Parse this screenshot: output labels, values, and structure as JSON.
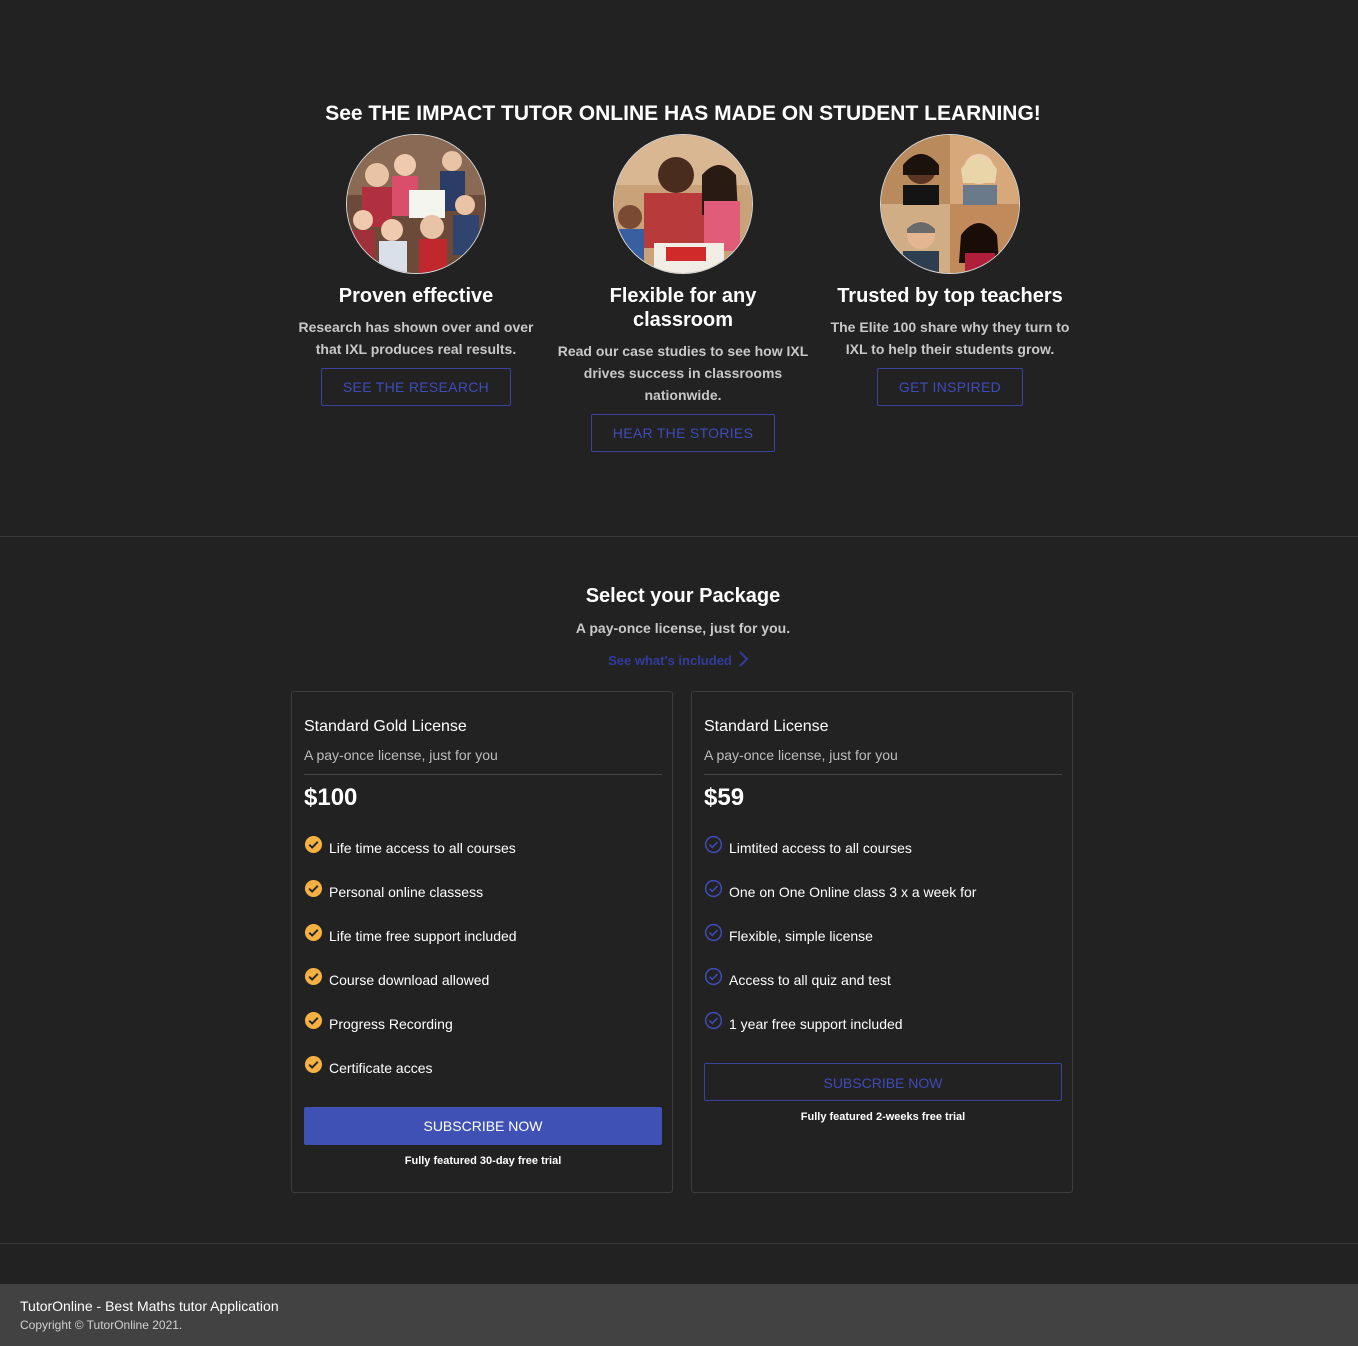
{
  "impact": {
    "title": "See THE IMPACT TUTOR ONLINE HAS MADE ON STUDENT LEARNING!",
    "features": [
      {
        "photo": "students-group-photo",
        "heading": "Proven effective",
        "text": "Research has shown over and over that IXL produces real results.",
        "button": "SEE THE RESEARCH"
      },
      {
        "photo": "teacher-with-students-photo",
        "heading": "Flexible for any classroom",
        "text": "Read our case studies to see how IXL drives success in classrooms nationwide.",
        "button": "HEAR THE STORIES"
      },
      {
        "photo": "teachers-collage-photo",
        "heading": "Trusted by top teachers",
        "text": "The Elite 100 share why they turn to IXL to help their students grow.",
        "button": "GET INSPIRED"
      }
    ]
  },
  "packages": {
    "title": "Select your Package",
    "subtitle": "A pay-once license, just for you.",
    "link": "See what's included",
    "plans": [
      {
        "name": "Standard Gold License",
        "desc": "A pay-once license, just for you",
        "price": "$100",
        "features": [
          "Life time access to all courses",
          "Personal online classess",
          "Life time free support included",
          "Course download allowed",
          "Progress Recording",
          "Certificate acces"
        ],
        "button": "SUBSCRIBE NOW",
        "trial": "Fully featured 30-day free trial"
      },
      {
        "name": "Standard License",
        "desc": "A pay-once license, just for you",
        "price": "$59",
        "features": [
          "Limtited access to all courses",
          "One on One Online class 3 x a week for",
          "Flexible, simple license",
          "Access to all quiz and test",
          "1 year free support included"
        ],
        "button": "SUBSCRIBE NOW",
        "trial": "Fully featured 2-weeks free trial"
      }
    ]
  },
  "footer": {
    "title": "TutorOnline - Best Maths tutor Application",
    "copyright": "Copyright © TutorOnline 2021."
  },
  "colors": {
    "background": "#222223",
    "accent": "#3f51b5",
    "gold_check": "#f5b042",
    "footer": "#424242"
  }
}
